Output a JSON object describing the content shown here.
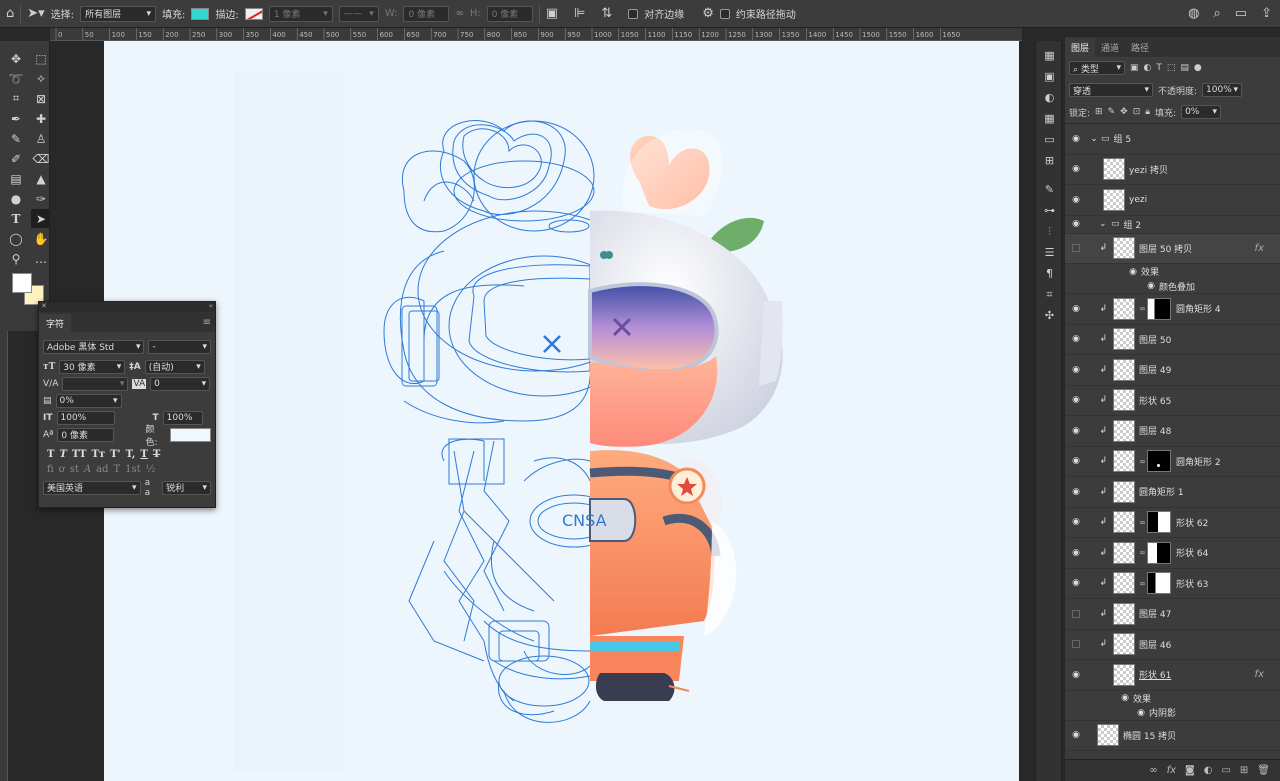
{
  "options_bar": {
    "select_label": "选择:",
    "select_value": "所有图层",
    "fill_label": "填充:",
    "fill_color": "#35d6cf",
    "stroke_label": "描边:",
    "stroke_width": "1 像素",
    "w_label": "W:",
    "w_value": "0 像素",
    "h_label": "H:",
    "h_value": "0 像素",
    "align_edges": "对齐边缘",
    "constrain_path": "约束路径拖动"
  },
  "ruler_ticks": [
    "0",
    "50",
    "100",
    "150",
    "200",
    "250",
    "300",
    "350",
    "400",
    "450",
    "500",
    "550",
    "600",
    "650",
    "700",
    "750",
    "800",
    "850",
    "900",
    "950",
    "1000",
    "1050",
    "1100",
    "1150",
    "1200",
    "1250",
    "1300",
    "1350",
    "1400",
    "1450",
    "1500",
    "1550",
    "1600",
    "1650"
  ],
  "character_panel": {
    "tab": "字符",
    "font_family": "Adobe 黑体 Std",
    "font_style": "-",
    "font_size": "30 像素",
    "leading": "(自动)",
    "kerning": "",
    "tracking": "0",
    "tsume": "0%",
    "vertical_scale": "100%",
    "horizontal_scale": "100%",
    "baseline_shift": "0 像素",
    "color_label": "颜色:",
    "language": "美国英语",
    "aa_label": "a a",
    "antialias": "锐利",
    "style_buttons": [
      "T",
      "T",
      "TT",
      "Tт",
      "T'",
      "T,",
      "T",
      "T"
    ],
    "opentype_buttons": [
      "fi",
      "ơ",
      "st",
      "A",
      "ad",
      "T",
      "1st",
      "½"
    ]
  },
  "layers_panel": {
    "tabs": [
      "图层",
      "通道",
      "路径"
    ],
    "filter_kind": "类型",
    "blend_mode": "穿透",
    "opacity_label": "不透明度:",
    "opacity": "100%",
    "lock_label": "锁定:",
    "fill_label": "填充:",
    "fill": "0%",
    "rows": [
      {
        "name": "组 5",
        "type": "group",
        "visible": true,
        "indent": 0
      },
      {
        "name": "yezi 拷贝",
        "type": "smart",
        "visible": true,
        "indent": 1
      },
      {
        "name": "yezi",
        "type": "smart",
        "visible": true,
        "indent": 1
      },
      {
        "name": "组 2",
        "type": "group",
        "visible": true,
        "indent": 1
      },
      {
        "name": "图层 50 拷贝",
        "type": "clip",
        "visible": false,
        "indent": 2,
        "fx": true
      },
      {
        "name": "图层 50",
        "type": "clip",
        "visible": true,
        "indent": 2
      },
      {
        "name": "图层 49",
        "type": "clip",
        "visible": true,
        "indent": 2
      },
      {
        "name": "形状 65",
        "type": "clip",
        "visible": true,
        "indent": 2
      },
      {
        "name": "图层 48",
        "type": "clip",
        "visible": true,
        "indent": 2
      },
      {
        "name": "圆角矩形 2",
        "type": "mask",
        "visible": true,
        "indent": 2
      },
      {
        "name": "圆角矩形 1",
        "type": "clip",
        "visible": true,
        "indent": 2
      },
      {
        "name": "形状 62",
        "type": "mask",
        "visible": true,
        "indent": 2
      },
      {
        "name": "形状 64",
        "type": "mask",
        "visible": true,
        "indent": 2
      },
      {
        "name": "形状 63",
        "type": "mask",
        "visible": true,
        "indent": 2
      },
      {
        "name": "图层 47",
        "type": "clip",
        "visible": false,
        "indent": 2
      },
      {
        "name": "图层 46",
        "type": "clip",
        "visible": false,
        "indent": 2
      },
      {
        "name": "形状 61",
        "type": "smart",
        "visible": true,
        "indent": 1,
        "fx": true
      },
      {
        "name": "椭圆 15 拷贝",
        "type": "smart",
        "visible": true,
        "indent": 0
      }
    ],
    "effects_label": "效果",
    "effect_overlay": "颜色叠加",
    "effect_inner_shadow": "内阴影",
    "mask_layer_name": "圆角矩形 4"
  },
  "canvas_text": {
    "badge": "CNSA"
  },
  "colors": {
    "canvas_bg": "#eef6fd",
    "wire": "#2e7ad6",
    "suit": "#f79466",
    "accent": "#35c6e6"
  }
}
